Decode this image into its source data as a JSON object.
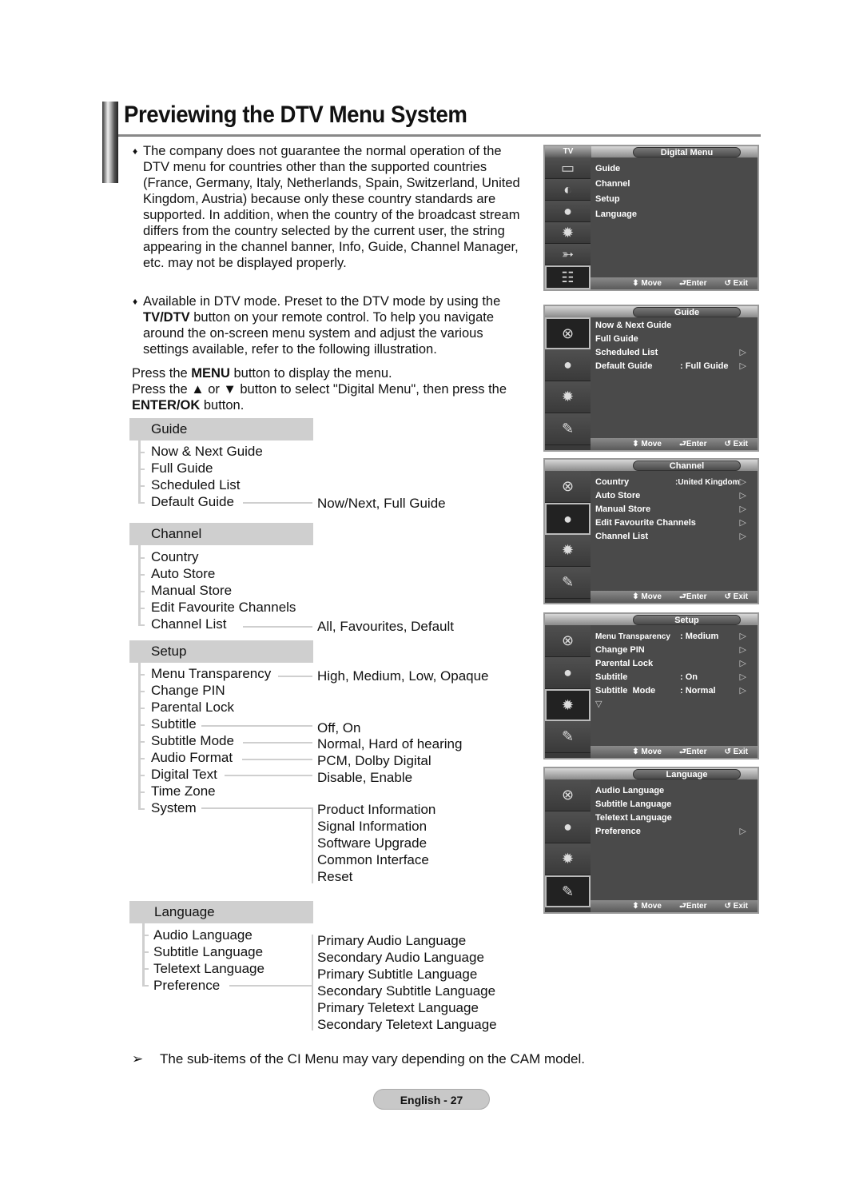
{
  "page": {
    "title": "Previewing the DTV Menu System",
    "footer_page": "English - 27"
  },
  "intro": {
    "bullet_symbol": "♦",
    "p1": "The company does not guarantee the normal operation of the DTV menu for countries other than the supported countries (France, Germany, Italy, Netherlands, Spain, Switzerland, United Kingdom, Austria) because only these country standards are supported. In addition, when the country of the broadcast stream differs from the country selected by the current user, the string appearing in the channel banner, Info, Guide, Channel Manager, etc. may not be displayed properly.",
    "p2_pre": "Available in DTV mode. Preset to the DTV mode by using the ",
    "p2_bold": "TV/DTV",
    "p2_post": " button on your remote control. To help you navigate around the on-screen menu system and adjust the various settings available, refer to the following illustration.",
    "p3a_pre": "Press the ",
    "p3a_bold": "MENU",
    "p3a_post": " button to display the menu.",
    "p3b_pre": "Press the ▲ or ▼ button to select \"Digital Menu\", then press the ",
    "p3b_bold": "ENTER/OK",
    "p3b_post": " button."
  },
  "tree": {
    "guide": {
      "heading": "Guide",
      "items": [
        "Now & Next Guide",
        "Full Guide",
        "Scheduled List",
        "Default Guide"
      ],
      "options": {
        "default_guide": "Now/Next, Full Guide"
      }
    },
    "channel": {
      "heading": "Channel",
      "items": [
        "Country",
        "Auto Store",
        "Manual Store",
        "Edit Favourite Channels",
        "Channel List"
      ],
      "options": {
        "channel_list": "All, Favourites, Default"
      }
    },
    "setup": {
      "heading": "Setup",
      "items": [
        "Menu Transparency",
        "Change PIN",
        "Parental Lock",
        "Subtitle",
        "Subtitle Mode",
        "Audio Format",
        "Digital Text",
        "Time Zone",
        "System"
      ],
      "options": {
        "menu_transparency": "High, Medium, Low, Opaque",
        "subtitle": "Off, On",
        "subtitle_mode": "Normal, Hard of hearing",
        "audio_format": "PCM, Dolby Digital",
        "digital_text": "Disable, Enable",
        "system": [
          "Product Information",
          "Signal Information",
          "Software Upgrade",
          "Common Interface",
          "Reset"
        ]
      }
    },
    "language": {
      "heading": "Language",
      "items": [
        "Audio Language",
        "Subtitle Language",
        "Teletext Language",
        "Preference"
      ],
      "options": {
        "preference": [
          "Primary Audio Language",
          "Secondary Audio Language",
          "Primary Subtitle Language",
          "Secondary Subtitle Language",
          "Primary Teletext Language",
          "Secondary Teletext Language"
        ]
      }
    }
  },
  "osd": {
    "footer": {
      "move": "Move",
      "enter": "Enter",
      "exit": "Exit"
    },
    "arrow": "▷",
    "down_arrow": "▽",
    "digital_menu": {
      "tab": "TV",
      "title": "Digital Menu",
      "items": [
        "Guide",
        "Channel",
        "Setup",
        "Language"
      ]
    },
    "guide": {
      "title": "Guide",
      "rows": [
        {
          "label": "Now & Next Guide",
          "value": "",
          "arrow": false
        },
        {
          "label": "Full Guide",
          "value": "",
          "arrow": false
        },
        {
          "label": "Scheduled List",
          "value": "",
          "arrow": true
        },
        {
          "label": "Default Guide",
          "value": ": Full Guide",
          "arrow": true
        }
      ]
    },
    "channel": {
      "title": "Channel",
      "rows": [
        {
          "label": "Country",
          "value": ":United Kingdom",
          "arrow": true
        },
        {
          "label": "Auto Store",
          "value": "",
          "arrow": true
        },
        {
          "label": "Manual Store",
          "value": "",
          "arrow": true
        },
        {
          "label": "Edit Favourite Channels",
          "value": "",
          "arrow": true
        },
        {
          "label": "Channel List",
          "value": "",
          "arrow": true
        }
      ]
    },
    "setup": {
      "title": "Setup",
      "rows": [
        {
          "label": "Menu Transparency",
          "value": ": Medium",
          "arrow": true
        },
        {
          "label": "Change PIN",
          "value": "",
          "arrow": true
        },
        {
          "label": "Parental Lock",
          "value": "",
          "arrow": true
        },
        {
          "label": "Subtitle",
          "value": ": On",
          "arrow": true
        },
        {
          "label": "Subtitle  Mode",
          "value": ": Normal",
          "arrow": true
        }
      ]
    },
    "language": {
      "title": "Language",
      "rows": [
        {
          "label": "Audio Language",
          "value": "",
          "arrow": false
        },
        {
          "label": "Subtitle Language",
          "value": "",
          "arrow": false
        },
        {
          "label": "Teletext Language",
          "value": "",
          "arrow": false
        },
        {
          "label": "Preference",
          "value": "",
          "arrow": true
        }
      ]
    }
  },
  "note": {
    "symbol": "➢",
    "text": "The sub-items of the CI Menu may vary depending on the CAM model."
  }
}
